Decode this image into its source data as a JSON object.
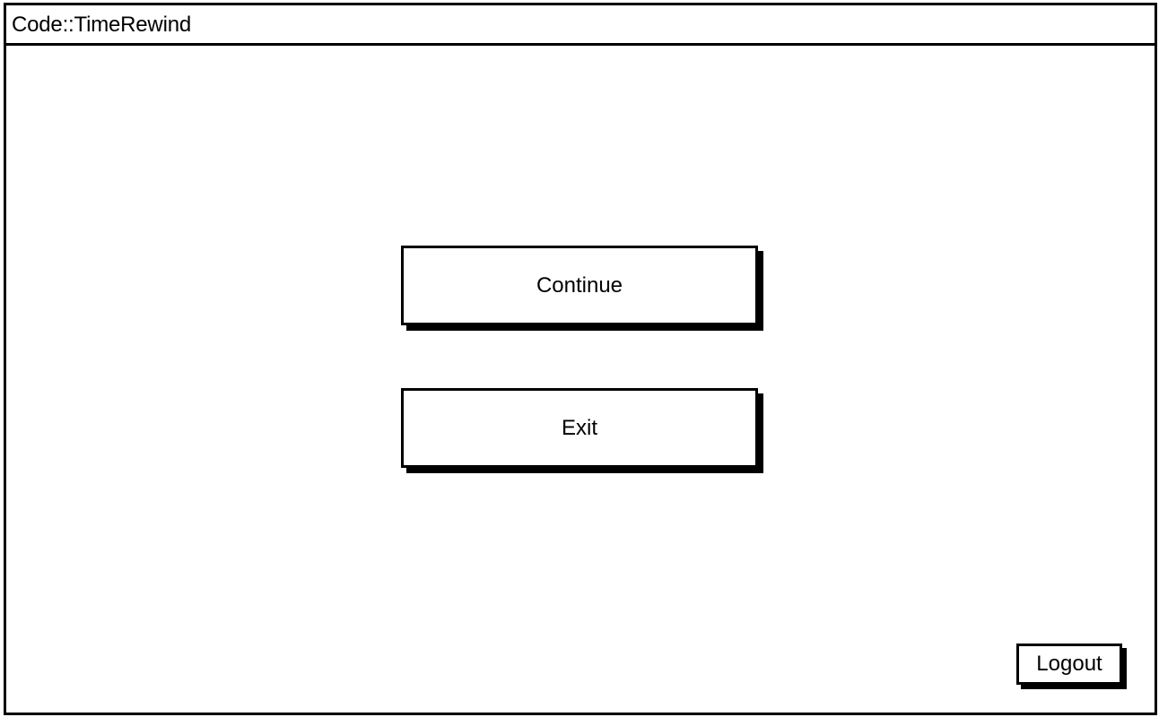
{
  "window": {
    "title": "Code::TimeRewind"
  },
  "menu": {
    "continue_label": "Continue",
    "exit_label": "Exit"
  },
  "footer": {
    "logout_label": "Logout"
  }
}
